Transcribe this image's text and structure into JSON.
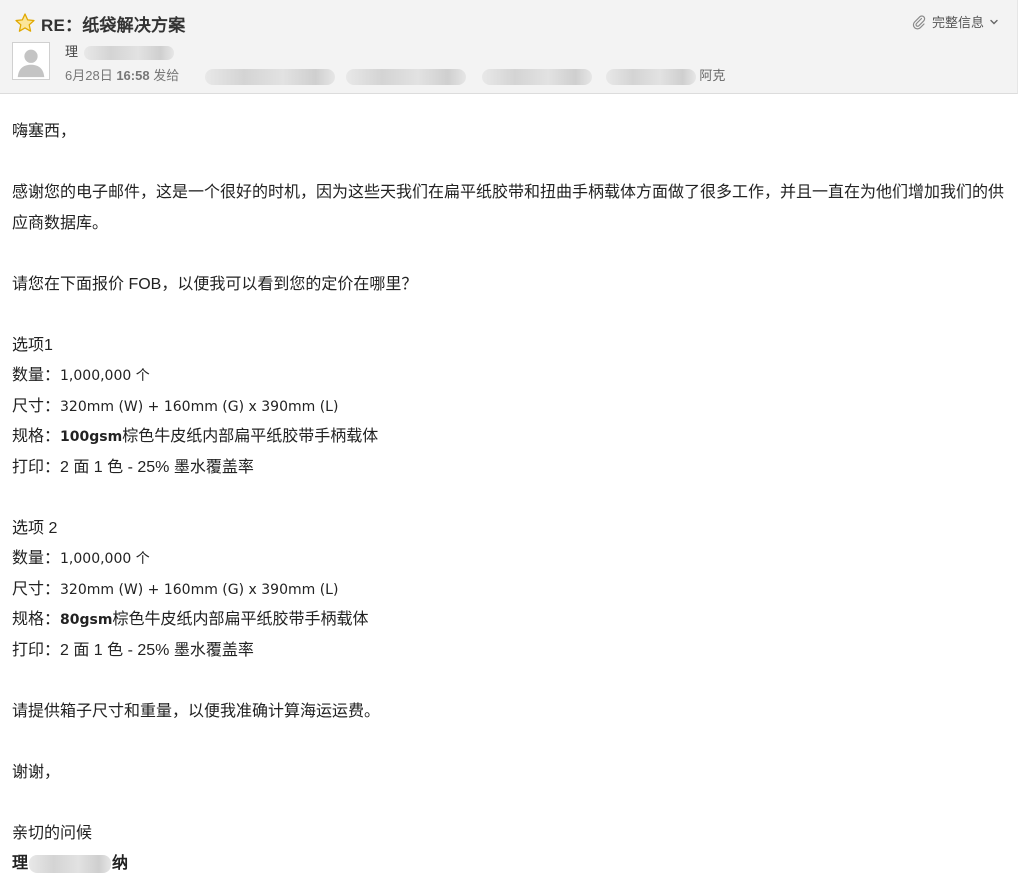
{
  "header": {
    "subject": "RE：纸袋解决方案",
    "details_label": "完整信息",
    "sender_name": "理",
    "date": "6月28日",
    "time": "16:58",
    "sent_to_label": "发给",
    "recipients_end": "阿克"
  },
  "body": {
    "greeting": "嗨塞西，",
    "para1": "感谢您的电子邮件，这是一个很好的时机，因为这些天我们在扁平纸胶带和扭曲手柄载体方面做了很多工作，并且一直在为他们增加我们的供应商数据库。",
    "para2": "请您在下面报价 FOB，以便我可以看到您的定价在哪里？",
    "option1": {
      "title": "选项1",
      "qty_label": "数量：",
      "qty_value": "1,000,000 个",
      "size_label": "尺寸：",
      "size_value": "320mm (W) + 160mm (G) x 390mm (L)",
      "spec_label": "规格：",
      "spec_bold": "100gsm",
      "spec_rest": "棕色牛皮纸内部扁平纸胶带手柄载体",
      "print_label": "打印：",
      "print_value": "2 面 1 色 - 25% 墨水覆盖率"
    },
    "option2": {
      "title": "选项 2",
      "qty_label": "数量：",
      "qty_value": "1,000,000 个",
      "size_label": "尺寸：",
      "size_value": "320mm (W) + 160mm (G) x 390mm (L)",
      "spec_label": "规格：",
      "spec_bold": "80gsm",
      "spec_rest": "棕色牛皮纸内部扁平纸胶带手柄载体",
      "print_label": "打印：",
      "print_value": "2 面 1 色 - 25% 墨水覆盖率"
    },
    "para3": "请提供箱子尺寸和重量，以便我准确计算海运运费。",
    "thanks": "谢谢，",
    "regards": "亲切的问候",
    "signature_first": "理",
    "signature_last": "纳"
  },
  "colors": {
    "header_bg": "#f3f3f3",
    "star": "#f4c21f",
    "text": "#222222"
  },
  "icons": {
    "star": "star-icon",
    "attachment": "paperclip-icon",
    "dropdown": "chevron-down-icon",
    "avatar": "person-avatar-icon"
  }
}
